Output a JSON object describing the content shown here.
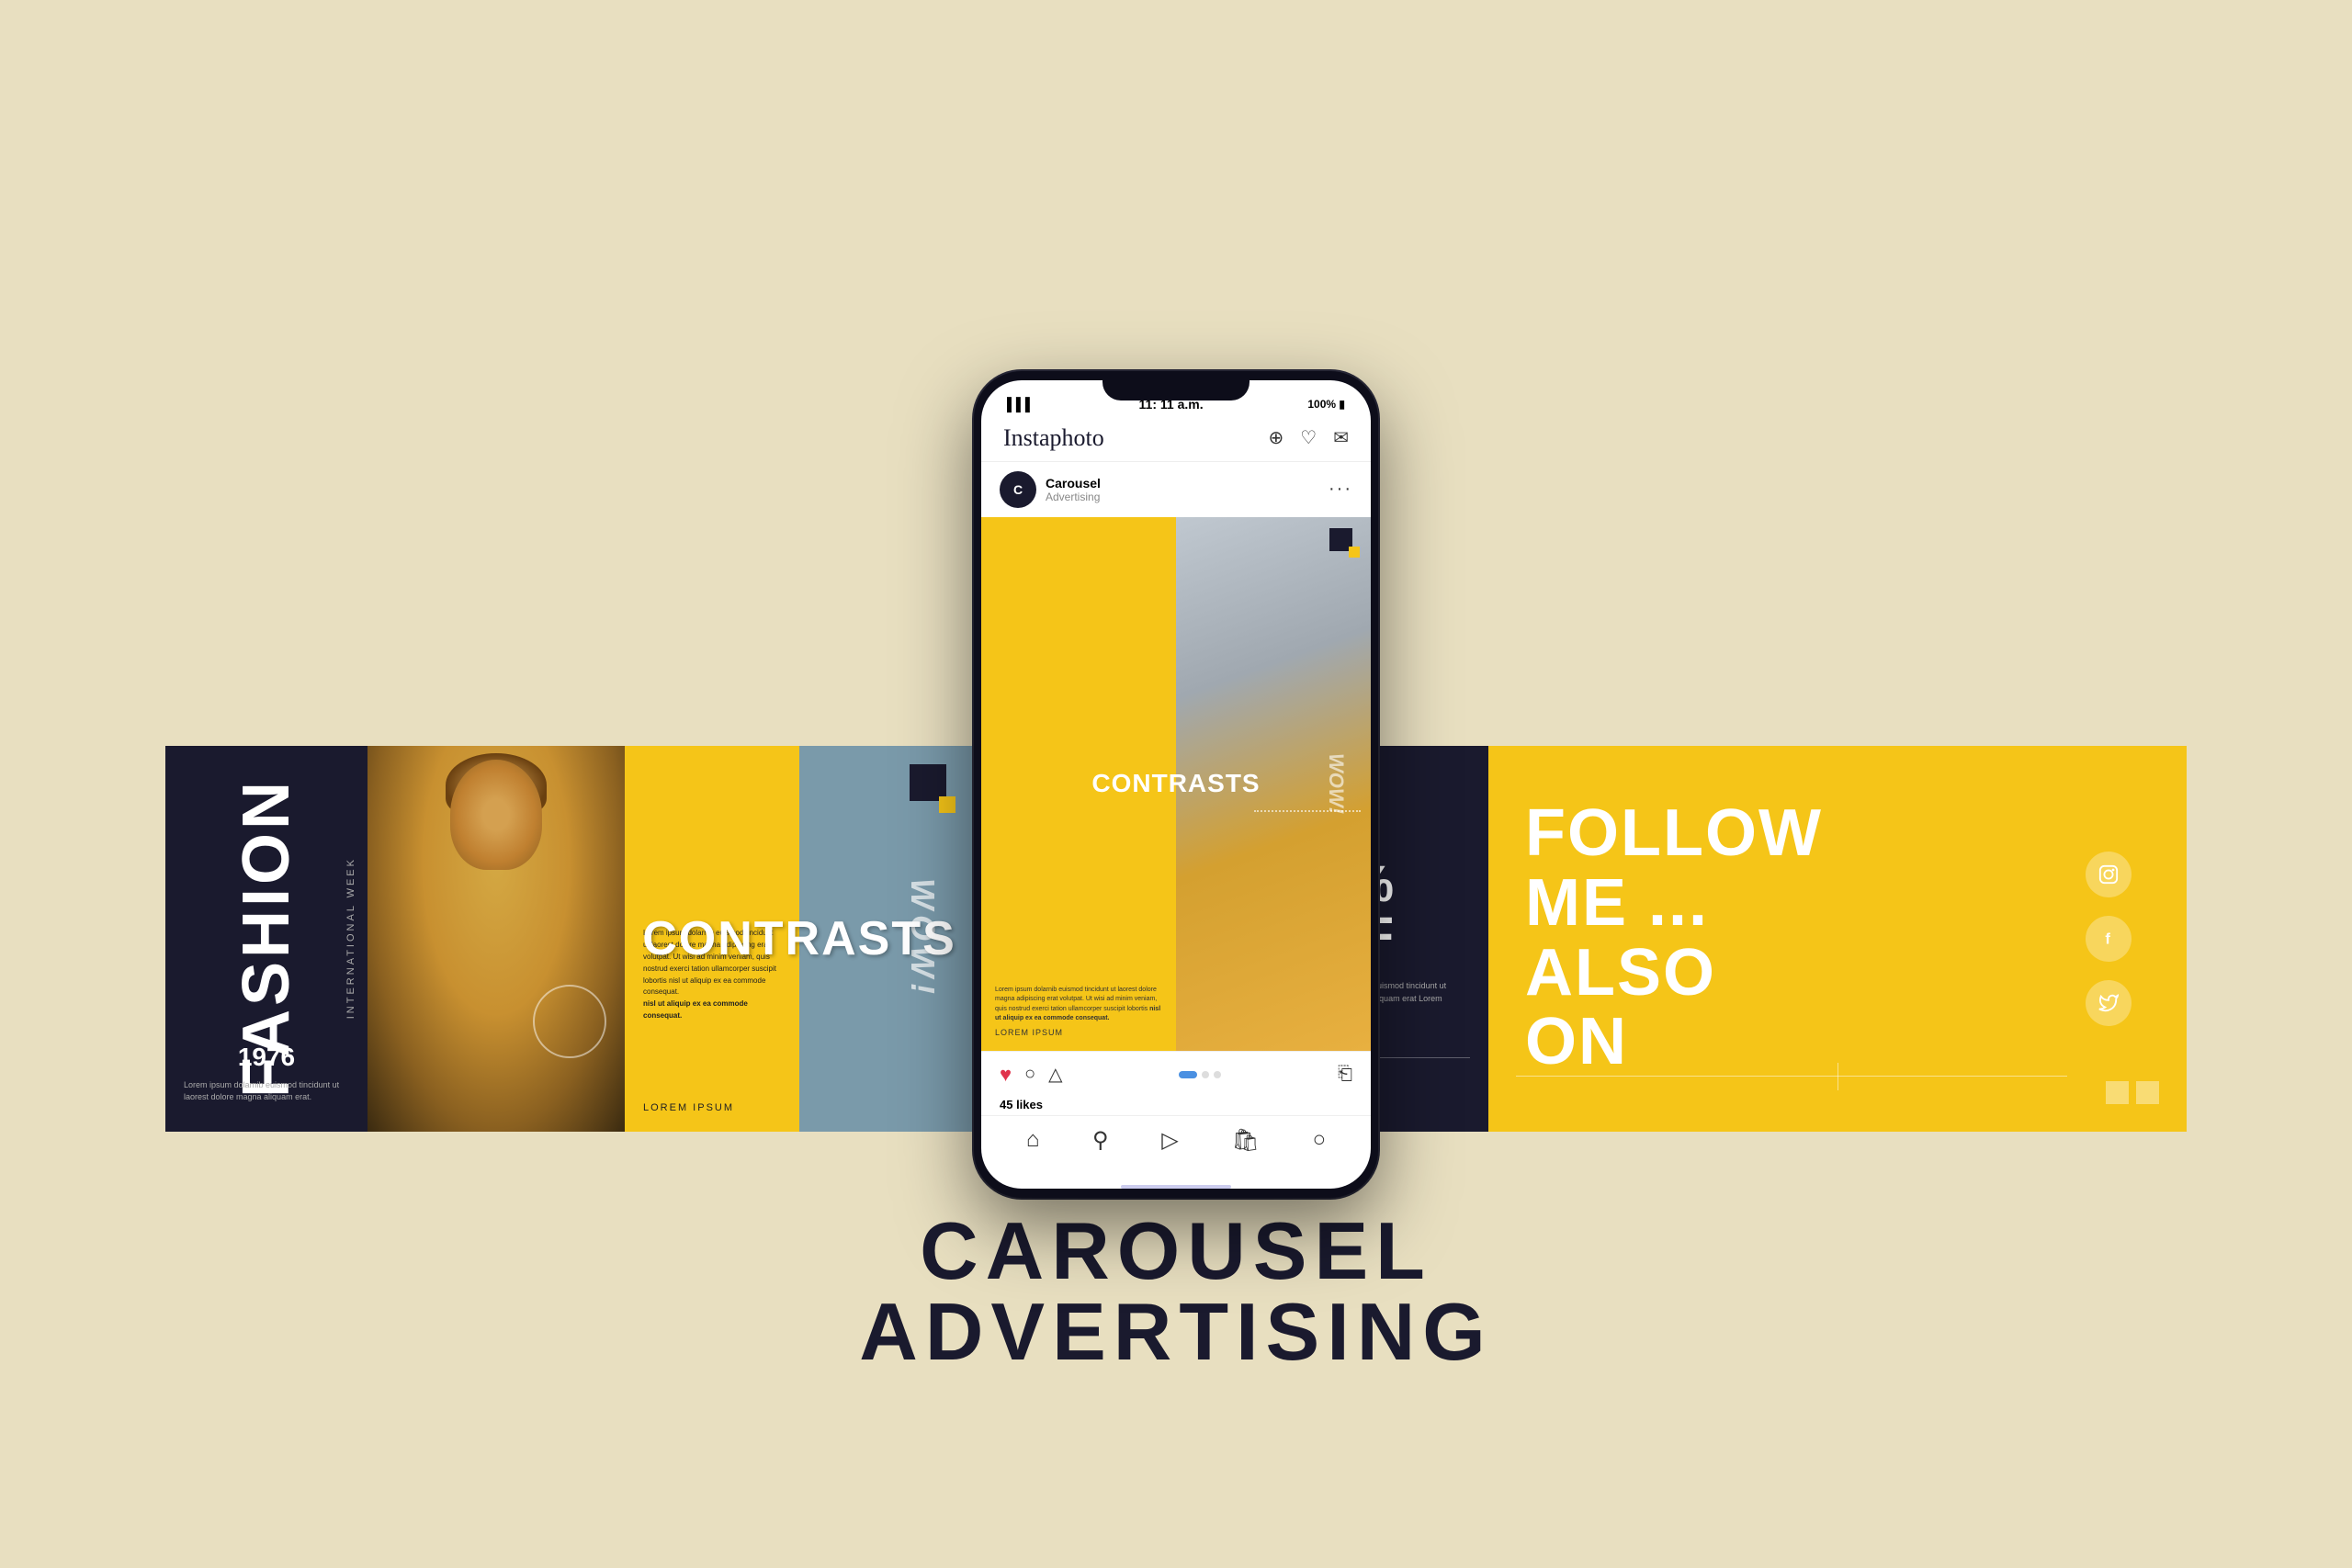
{
  "page": {
    "background": "#e8dfc0",
    "title": "Carousel Advertising"
  },
  "phone": {
    "status_bar": {
      "signal": "|||",
      "time": "11: 11 a.m.",
      "battery": "100%"
    },
    "app_name": "Instaphoto",
    "post": {
      "username": "Carousel",
      "handle": "Advertising",
      "likes": "45 likes",
      "contrasts_label": "CONTRASTS",
      "lorem_label": "LOREM IPSUM",
      "wow_label": "WOW!",
      "body_text": "Lorem ipsum dolarnib euismod tincidunt ut laorest dolore magna adipiscing erat volutpat. Ut wisi ad minim veniam, quis nostrud exerci tation ullamcorper suscipit lobortis nisl ut aliquip ex ea commode consequat.",
      "bold_text": "nisl ut aliquip ex ea commode consequat."
    }
  },
  "carousel": {
    "panel1": {
      "fashion": "FASHION",
      "international": "INTERNATIONAL WEEK",
      "year": "1976",
      "desc": "Lorem ipsum dolarnib euismod tincidunt ut laorest dolore magna aliquam erat."
    },
    "panel3": {
      "title": "CONTRASTS",
      "wow": "WOW!",
      "lorem": "LOREM IPSUM",
      "body": "Lorem ipsum dolarnib euismod tincidunt ut laorest dolore magna adipiscing erat volutpat. Ut wisi ad minim veniam, quis nostrud exerci tation ullamcorper suscipit lobortis nisl ut aliquip ex ea commode consequat.",
      "bold_text": "nisl ut aliquip ex ea commode consequat."
    },
    "panel5": {
      "discount": "50%",
      "off": "OFF",
      "desc": "Lorem ipsum dolornib euismod tincidunt ut laorest dolore magna aliquam erat Lorem ipsum dolor sit amet."
    },
    "panel6": {
      "line1": "FOLLOW",
      "line2": "ME ...",
      "line3": "ALSO",
      "line4": "ON",
      "social": [
        "instagram",
        "facebook",
        "twitter"
      ]
    }
  }
}
